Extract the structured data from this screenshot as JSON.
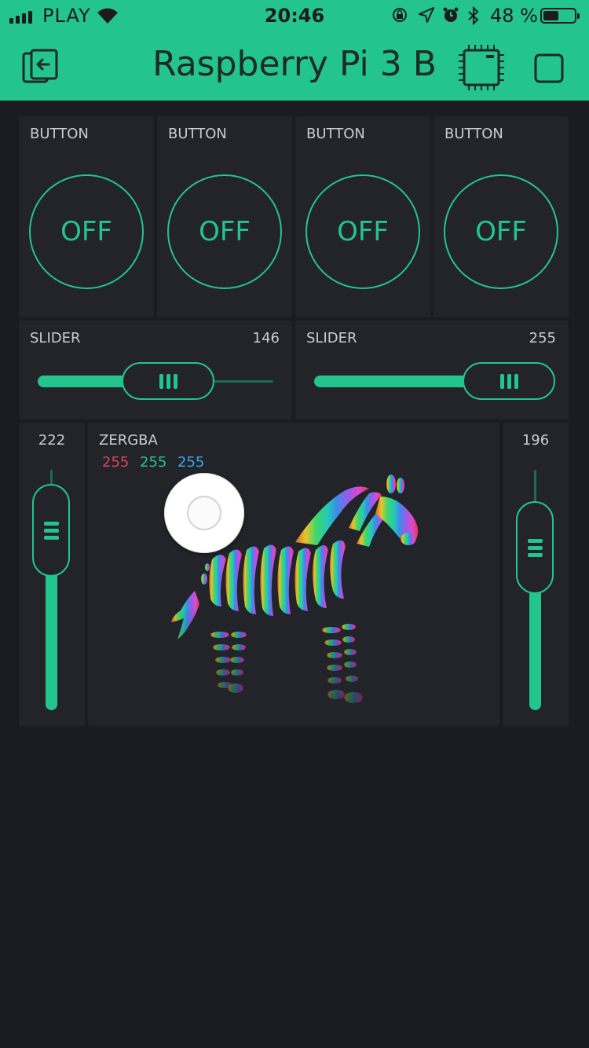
{
  "status_bar": {
    "carrier": "PLAY",
    "time": "20:46",
    "battery_text": "48 %",
    "battery_level": 0.48,
    "icons": [
      "signal-icon",
      "wifi-icon",
      "orientation-lock-icon",
      "location-icon",
      "alarm-icon",
      "bluetooth-icon",
      "battery-icon"
    ]
  },
  "header": {
    "title": "Raspberry Pi 3 B",
    "icons": [
      "exit-icon",
      "device-chip-icon",
      "stop-icon"
    ]
  },
  "buttons": [
    {
      "label": "BUTTON",
      "state": "OFF"
    },
    {
      "label": "BUTTON",
      "state": "OFF"
    },
    {
      "label": "BUTTON",
      "state": "OFF"
    },
    {
      "label": "BUTTON",
      "state": "OFF"
    }
  ],
  "sliders": [
    {
      "label": "SLIDER",
      "value": "146",
      "level": 0.57
    },
    {
      "label": "SLIDER",
      "value": "255",
      "level": 1.0
    }
  ],
  "vertical_sliders": [
    {
      "value": "222",
      "level": 0.87
    },
    {
      "value": "196",
      "level": 0.77
    }
  ],
  "zergba": {
    "label": "ZERGBA",
    "r": "255",
    "g": "255",
    "b": "255"
  },
  "colors": {
    "accent": "#23c48e",
    "background": "#1a1c21",
    "widget": "#22242a",
    "red": "#e0425f",
    "green": "#23c48e",
    "blue": "#3aa8e8"
  }
}
